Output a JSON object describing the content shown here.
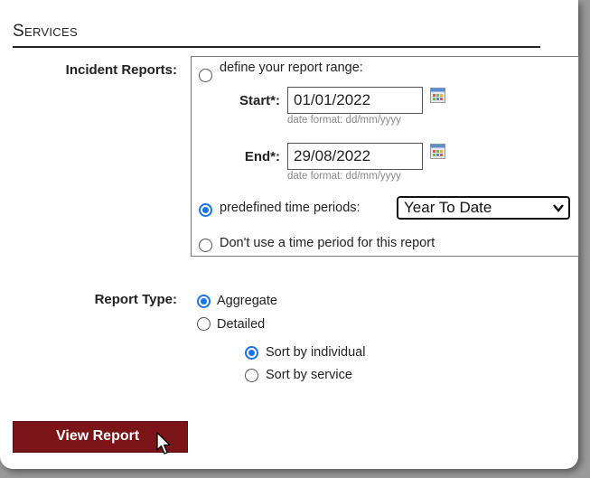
{
  "section": {
    "title": "Services"
  },
  "incident": {
    "label": "Incident Reports:",
    "define_range_label": "define your report range:",
    "start_label": "Start*:",
    "start_value": "01/01/2022",
    "end_label": "End*:",
    "end_value": "29/08/2022",
    "date_hint": "date format: dd/mm/yyyy",
    "predefined_label": "predefined time periods:",
    "predefined_selected": "Year To Date",
    "no_period_label": "Don't use a time period for this report"
  },
  "report_type": {
    "label": "Report Type:",
    "aggregate": "Aggregate",
    "detailed": "Detailed",
    "sort_individual": "Sort by individual",
    "sort_service": "Sort by service"
  },
  "actions": {
    "view_report": "View Report"
  },
  "colors": {
    "accent": "#1a73e8",
    "button_bg": "#7b1418",
    "button_text": "#ffffff"
  },
  "icons": {
    "calendar": "calendar-icon",
    "chevron": "chevron-down-icon",
    "cursor": "mouse-pointer-icon"
  }
}
